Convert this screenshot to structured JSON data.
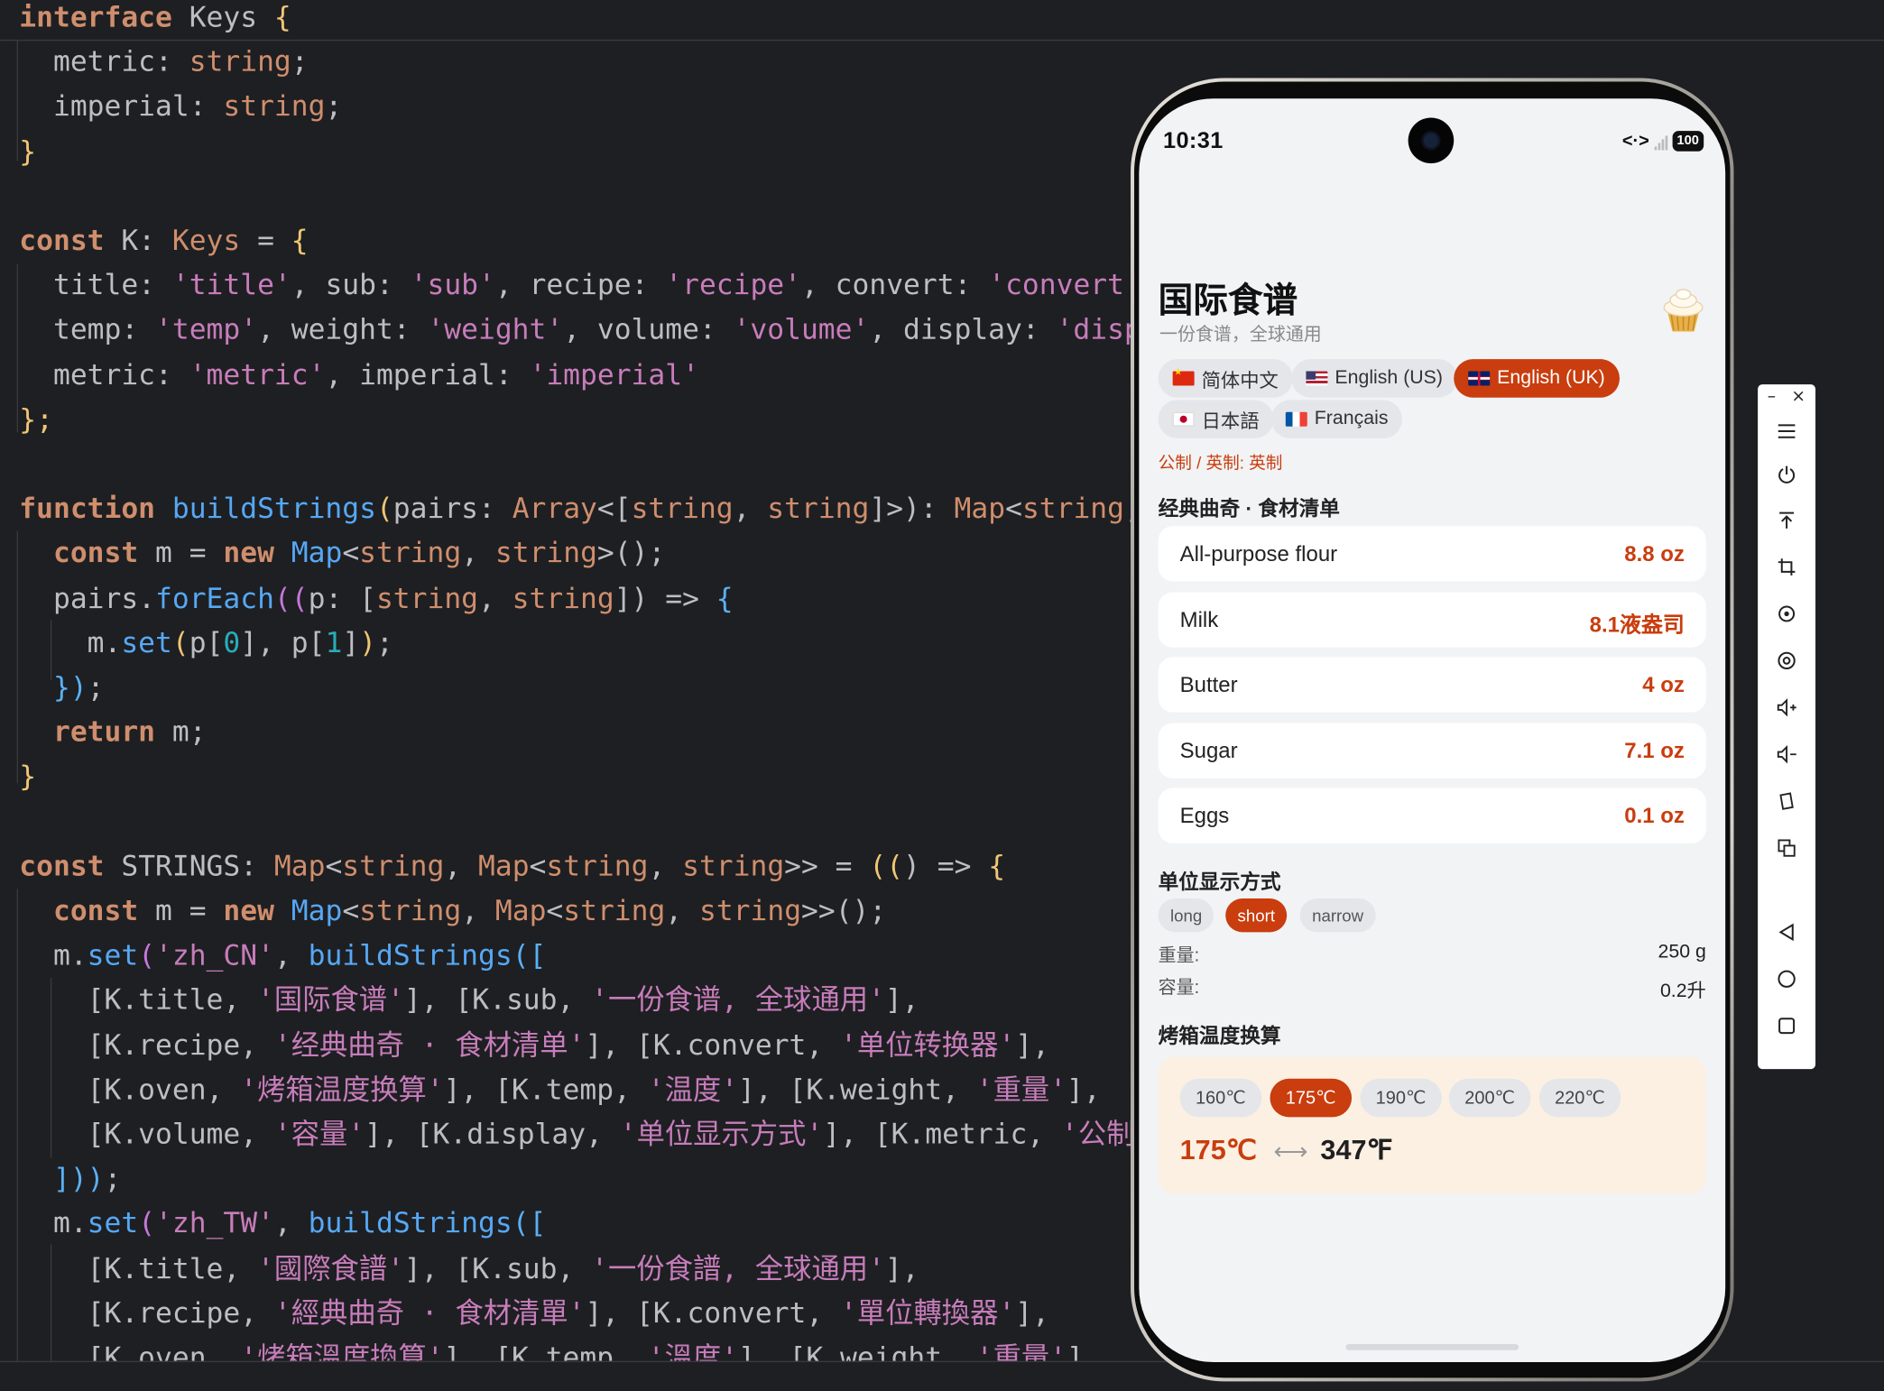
{
  "editor": {
    "lines": [
      [
        [
          "interface",
          "kw"
        ],
        [
          " Keys ",
          ""
        ],
        [
          "{",
          "br1"
        ]
      ],
      [
        [
          "  metric: ",
          ""
        ],
        [
          "string",
          "type"
        ],
        [
          ";",
          ""
        ]
      ],
      [
        [
          "  imperial: ",
          ""
        ],
        [
          "string",
          "type"
        ],
        [
          ";",
          ""
        ]
      ],
      [
        [
          "}",
          "br1"
        ]
      ],
      [
        [
          "",
          ""
        ]
      ],
      [
        [
          "const",
          "kw"
        ],
        [
          " K: ",
          ""
        ],
        [
          "Keys",
          "type"
        ],
        [
          " = ",
          ""
        ],
        [
          "{",
          "br1"
        ]
      ],
      [
        [
          "  title: ",
          ""
        ],
        [
          "'title'",
          "str"
        ],
        [
          ", sub: ",
          ""
        ],
        [
          "'sub'",
          "str"
        ],
        [
          ", recipe: ",
          ""
        ],
        [
          "'recipe'",
          "str"
        ],
        [
          ", convert: ",
          ""
        ],
        [
          "'convert'",
          "str"
        ],
        [
          ", c",
          ""
        ]
      ],
      [
        [
          "  temp: ",
          ""
        ],
        [
          "'temp'",
          "str"
        ],
        [
          ", weight: ",
          ""
        ],
        [
          "'weight'",
          "str"
        ],
        [
          ", volume: ",
          ""
        ],
        [
          "'volume'",
          "str"
        ],
        [
          ", display: ",
          ""
        ],
        [
          "'display",
          "str"
        ]
      ],
      [
        [
          "  metric: ",
          ""
        ],
        [
          "'metric'",
          "str"
        ],
        [
          ", imperial: ",
          ""
        ],
        [
          "'imperial'",
          "str"
        ]
      ],
      [
        [
          "};",
          "br1"
        ]
      ],
      [
        [
          "",
          ""
        ]
      ],
      [
        [
          "function",
          "kw"
        ],
        [
          " ",
          ""
        ],
        [
          "buildStrings",
          "fn"
        ],
        [
          "(",
          "br1"
        ],
        [
          "pairs: ",
          ""
        ],
        [
          "Array",
          "type"
        ],
        [
          "<[",
          ""
        ],
        [
          "string",
          "type"
        ],
        [
          ", ",
          ""
        ],
        [
          "string",
          "type"
        ],
        [
          "]>",
          ""
        ],
        [
          "): ",
          ""
        ],
        [
          "Map",
          "type"
        ],
        [
          "<",
          ""
        ],
        [
          "string",
          "type"
        ],
        [
          ", st",
          ""
        ]
      ],
      [
        [
          "  ",
          ""
        ],
        [
          "const",
          "kw"
        ],
        [
          " m = ",
          ""
        ],
        [
          "new",
          "kw"
        ],
        [
          " ",
          ""
        ],
        [
          "Map",
          "fn"
        ],
        [
          "<",
          ""
        ],
        [
          "string",
          "type"
        ],
        [
          ", ",
          ""
        ],
        [
          "string",
          "type"
        ],
        [
          ">();",
          ""
        ]
      ],
      [
        [
          "  pairs.",
          ""
        ],
        [
          "forEach",
          "fn"
        ],
        [
          "((",
          "br2"
        ],
        [
          "p: [",
          ""
        ],
        [
          "string",
          "type"
        ],
        [
          ", ",
          ""
        ],
        [
          "string",
          "type"
        ],
        [
          "]) => ",
          ""
        ],
        [
          "{",
          "br3"
        ]
      ],
      [
        [
          "    m.",
          ""
        ],
        [
          "set",
          "fn"
        ],
        [
          "(",
          "br1"
        ],
        [
          "p[",
          ""
        ],
        [
          "0",
          "num"
        ],
        [
          "], p[",
          ""
        ],
        [
          "1",
          "num"
        ],
        [
          "]",
          ""
        ],
        [
          ")",
          "br1"
        ],
        [
          ";",
          ""
        ]
      ],
      [
        [
          "  ",
          ""
        ],
        [
          "})",
          "br3"
        ],
        [
          ";",
          ""
        ]
      ],
      [
        [
          "  ",
          ""
        ],
        [
          "return",
          "kw"
        ],
        [
          " m;",
          ""
        ]
      ],
      [
        [
          "}",
          "br1"
        ]
      ],
      [
        [
          "",
          ""
        ]
      ],
      [
        [
          "const",
          "kw"
        ],
        [
          " STRINGS: ",
          ""
        ],
        [
          "Map",
          "type"
        ],
        [
          "<",
          ""
        ],
        [
          "string",
          "type"
        ],
        [
          ", ",
          ""
        ],
        [
          "Map",
          "type"
        ],
        [
          "<",
          ""
        ],
        [
          "string",
          "type"
        ],
        [
          ", ",
          ""
        ],
        [
          "string",
          "type"
        ],
        [
          ">> = ",
          ""
        ],
        [
          "((",
          "br1"
        ],
        [
          ") => ",
          ""
        ],
        [
          "{",
          "br1"
        ]
      ],
      [
        [
          "  ",
          ""
        ],
        [
          "const",
          "kw"
        ],
        [
          " m = ",
          ""
        ],
        [
          "new",
          "kw"
        ],
        [
          " ",
          ""
        ],
        [
          "Map",
          "fn"
        ],
        [
          "<",
          ""
        ],
        [
          "string",
          "type"
        ],
        [
          ", ",
          ""
        ],
        [
          "Map",
          "type"
        ],
        [
          "<",
          ""
        ],
        [
          "string",
          "type"
        ],
        [
          ", ",
          ""
        ],
        [
          "string",
          "type"
        ],
        [
          ">>();",
          ""
        ]
      ],
      [
        [
          "  m.",
          ""
        ],
        [
          "set",
          "fn"
        ],
        [
          "(",
          "br2"
        ],
        [
          "'zh_CN'",
          "str"
        ],
        [
          ", ",
          ""
        ],
        [
          "buildStrings",
          "fn"
        ],
        [
          "([",
          "br3"
        ]
      ],
      [
        [
          "    [K.title, ",
          ""
        ],
        [
          "'国际食谱'",
          "str"
        ],
        [
          "], [K.sub, ",
          ""
        ],
        [
          "'一份食谱, 全球通用'",
          "str"
        ],
        [
          "],",
          ""
        ]
      ],
      [
        [
          "    [K.recipe, ",
          ""
        ],
        [
          "'经典曲奇 · 食材清单'",
          "str"
        ],
        [
          "], [K.convert, ",
          ""
        ],
        [
          "'单位转换器'",
          "str"
        ],
        [
          "],",
          ""
        ]
      ],
      [
        [
          "    [K.oven, ",
          ""
        ],
        [
          "'烤箱温度换算'",
          "str"
        ],
        [
          "], [K.temp, ",
          ""
        ],
        [
          "'温度'",
          "str"
        ],
        [
          "], [K.weight, ",
          ""
        ],
        [
          "'重量'",
          "str"
        ],
        [
          "],",
          ""
        ]
      ],
      [
        [
          "    [K.volume, ",
          ""
        ],
        [
          "'容量'",
          "str"
        ],
        [
          "], [K.display, ",
          ""
        ],
        [
          "'单位显示方式'",
          "str"
        ],
        [
          "], [K.metric, ",
          ""
        ],
        [
          "'公制'",
          "str"
        ],
        [
          "],",
          ""
        ]
      ],
      [
        [
          "  ",
          ""
        ],
        [
          "]))",
          "br3"
        ],
        [
          ";",
          ""
        ]
      ],
      [
        [
          "  m.",
          ""
        ],
        [
          "set",
          "fn"
        ],
        [
          "(",
          "br2"
        ],
        [
          "'zh_TW'",
          "str"
        ],
        [
          ", ",
          ""
        ],
        [
          "buildStrings",
          "fn"
        ],
        [
          "([",
          "br3"
        ]
      ],
      [
        [
          "    [K.title, ",
          ""
        ],
        [
          "'國際食譜'",
          "str"
        ],
        [
          "], [K.sub, ",
          ""
        ],
        [
          "'一份食譜, 全球通用'",
          "str"
        ],
        [
          "],",
          ""
        ]
      ],
      [
        [
          "    [K.recipe, ",
          ""
        ],
        [
          "'經典曲奇 · 食材清單'",
          "str"
        ],
        [
          "], [K.convert, ",
          ""
        ],
        [
          "'單位轉換器'",
          "str"
        ],
        [
          "],",
          ""
        ]
      ],
      [
        [
          "    [K.oven, ",
          ""
        ],
        [
          "'烤箱溫度換算'",
          "str"
        ],
        [
          "], [K.temp, ",
          ""
        ],
        [
          "'溫度'",
          "str"
        ],
        [
          "], [K.weight, ",
          ""
        ],
        [
          "'重量'",
          "str"
        ],
        [
          "]",
          ""
        ]
      ]
    ]
  },
  "phone": {
    "status": {
      "time": "10:31",
      "battery": "100"
    },
    "title": "国际食谱",
    "subtitle": "一份食谱，全球通用",
    "icon": "cupcake-icon",
    "languages": [
      {
        "label": "简体中文",
        "flag": "cn",
        "active": false
      },
      {
        "label": "English (US)",
        "flag": "us",
        "active": false
      },
      {
        "label": "English (UK)",
        "flag": "uk",
        "active": true
      },
      {
        "label": "日本語",
        "flag": "jp",
        "active": false
      },
      {
        "label": "Français",
        "flag": "fr",
        "active": false
      }
    ],
    "system_label": "公制 / 英制: 英制",
    "recipe_title": "经典曲奇 · 食材清单",
    "ingredients": [
      {
        "name": "All-purpose flour",
        "value": "8.8 oz"
      },
      {
        "name": "Milk",
        "value": "8.1液盎司"
      },
      {
        "name": "Butter",
        "value": "4 oz"
      },
      {
        "name": "Sugar",
        "value": "7.1 oz"
      },
      {
        "name": "Eggs",
        "value": "0.1 oz"
      }
    ],
    "display_title": "单位显示方式",
    "display_options": [
      {
        "label": "long",
        "active": false
      },
      {
        "label": "short",
        "active": true
      },
      {
        "label": "narrow",
        "active": false
      }
    ],
    "weight_label": "重量:",
    "weight_value": "250 g",
    "volume_label": "容量:",
    "volume_value": "0.2升",
    "oven_title": "烤箱温度换算",
    "temps": [
      {
        "label": "160℃",
        "active": false
      },
      {
        "label": "175℃",
        "active": true
      },
      {
        "label": "190℃",
        "active": false
      },
      {
        "label": "200℃",
        "active": false
      },
      {
        "label": "220℃",
        "active": false
      }
    ],
    "celsius": "175℃",
    "arrow": "⟷",
    "fahrenheit": "347℉",
    "accent_color": "#c93d0e"
  },
  "toolbar": {
    "minimize": "–",
    "close": "×",
    "buttons": [
      "menu-icon",
      "power-icon",
      "pin-top-icon",
      "crop-icon",
      "rotate-icon",
      "screenshot-icon",
      "volume-up-icon",
      "volume-down-icon",
      "fold-icon",
      "multi-screen-icon",
      "back-icon",
      "home-icon",
      "recents-icon"
    ]
  }
}
